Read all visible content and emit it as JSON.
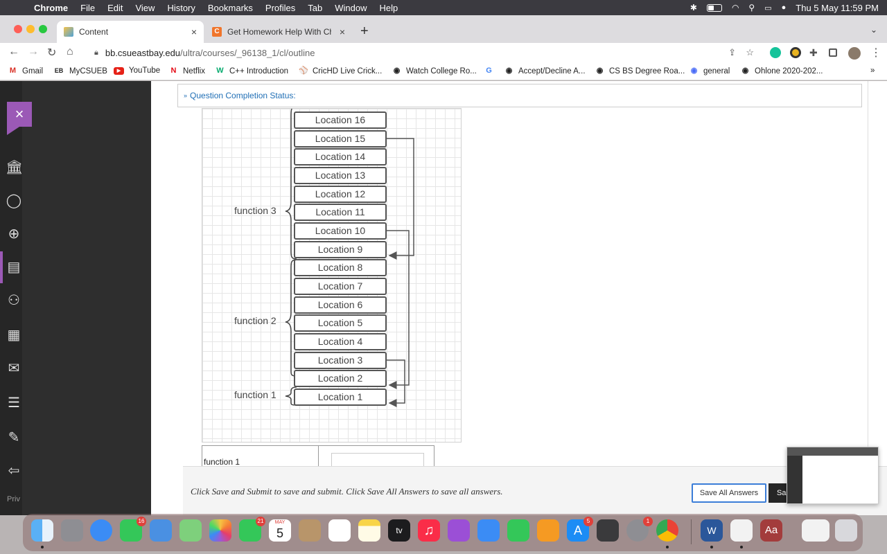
{
  "menubar": {
    "app": "Chrome",
    "items": [
      "File",
      "Edit",
      "View",
      "History",
      "Bookmarks",
      "Profiles",
      "Tab",
      "Window",
      "Help"
    ],
    "clock": "Thu 5 May  11:59 PM"
  },
  "tabs": [
    {
      "title": "Content",
      "favicon_color": "#d9a441"
    },
    {
      "title": "Get Homework Help With Cheg",
      "favicon_color": "#f0752b"
    }
  ],
  "address": {
    "host": "bb.csueastbay.edu",
    "path": "/ultra/courses/_96138_1/cl/outline"
  },
  "bookmarks": [
    {
      "label": "Gmail",
      "icon": "gmail-icon",
      "glyph": "M",
      "color": "#d93025"
    },
    {
      "label": "MyCSUEB",
      "icon": "mycsueb-icon",
      "glyph": "EB",
      "color": "#222"
    },
    {
      "label": "YouTube",
      "icon": "youtube-icon",
      "glyph": "▶",
      "color": "#e62117"
    },
    {
      "label": "Netflix",
      "icon": "netflix-icon",
      "glyph": "N",
      "color": "#e50914"
    },
    {
      "label": "C++ Introduction",
      "icon": "w3schools-icon",
      "glyph": "W",
      "color": "#04aa6d"
    },
    {
      "label": "CricHD Live Crick...",
      "icon": "cricket-icon",
      "glyph": "⚾",
      "color": "#b5651d"
    },
    {
      "label": "Watch College Ro...",
      "icon": "globe-icon",
      "glyph": "◉",
      "color": "#333"
    },
    {
      "label": "",
      "icon": "google-icon",
      "glyph": "G",
      "color": "#4285f4"
    },
    {
      "label": "Accept/Decline A...",
      "icon": "globe-icon",
      "glyph": "◉",
      "color": "#333"
    },
    {
      "label": "CS BS Degree Roa...",
      "icon": "globe-icon",
      "glyph": "◉",
      "color": "#333"
    },
    {
      "label": "general",
      "icon": "general-icon",
      "glyph": "◉",
      "color": "#4a6cf7"
    },
    {
      "label": "Ohlone 2020-202...",
      "icon": "globe-icon",
      "glyph": "◉",
      "color": "#333"
    }
  ],
  "question": {
    "status_label": "Question Completion Status:"
  },
  "diagram": {
    "locations": [
      "Location 16",
      "Location 15",
      "Location 14",
      "Location 13",
      "Location 12",
      "Location 11",
      "Location 10",
      "Location 9",
      "Location 8",
      "Location 7",
      "Location 6",
      "Location 5",
      "Location 4",
      "Location 3",
      "Location 2",
      "Location 1"
    ],
    "functions": [
      "function 3",
      "function 2",
      "function 1"
    ]
  },
  "answer_row": {
    "label": "function 1",
    "value": ""
  },
  "footer": {
    "hint": "Click Save and Submit to save and submit. Click Save All Answers to save all answers.",
    "save_all": "Save All Answers",
    "save_submit": "Sa"
  },
  "sidebar": {
    "privacy": "Priv"
  },
  "dock": {
    "messages_badge": "16",
    "facetime_badge": "21",
    "calendar_month": "MAY",
    "calendar_day": "5",
    "appstore_badge": "5",
    "settings_badge": "1",
    "tv_label": "tv",
    "dictionary_label": "Aa"
  }
}
